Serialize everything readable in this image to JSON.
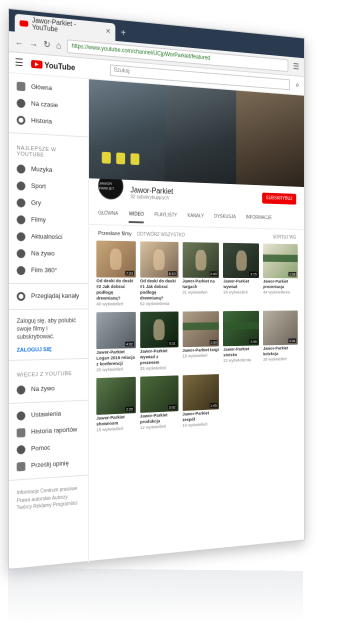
{
  "browser": {
    "tab_title": "Jawor-Parkiet - YouTube",
    "new_tab": "+",
    "url": "https://www.youtube.com/channel/UCjpWorParkiet/featured",
    "nav_icons": [
      "back-icon",
      "forward-icon",
      "refresh-icon",
      "home-icon"
    ]
  },
  "yt": {
    "logo_text": "YouTube",
    "search_placeholder": "Szukaj"
  },
  "sidebar": {
    "primary": [
      {
        "label": "Główna",
        "icon": "home-icon"
      },
      {
        "label": "Na czasie",
        "icon": "fire-icon"
      },
      {
        "label": "Historia",
        "icon": "history-icon"
      }
    ],
    "best_header": "NAJLEPSZE W YOUTUBE",
    "best": [
      {
        "label": "Muzyka"
      },
      {
        "label": "Sport"
      },
      {
        "label": "Gry"
      },
      {
        "label": "Filmy"
      },
      {
        "label": "Aktualności"
      },
      {
        "label": "Na żywo"
      },
      {
        "label": "Film 360°"
      }
    ],
    "browse": "Przeglądaj kanały",
    "signin_text": "Zaloguj się, aby polubić swoje filmy i subskrybować.",
    "signin_button": "ZALOGUJ SIĘ",
    "more_header": "WIĘCEJ Z YOUTUBE",
    "more": [
      {
        "label": "Na żywo"
      }
    ],
    "settings": [
      {
        "label": "Ustawienia"
      },
      {
        "label": "Historia raportów"
      },
      {
        "label": "Pomoc"
      },
      {
        "label": "Prześlij opinię"
      }
    ],
    "footer": "Informacje  Centrum prasowe  Prawa autorskie  Autorzy  Twórcy  Reklamy  Programiści"
  },
  "channel": {
    "avatar_text": "JAWOR PARKIET",
    "name": "Jawor-Parkiet",
    "subscribers": "92 subskrybujących",
    "subscribe": "SUBSKRYBUJ",
    "tabs": [
      "GŁÓWNA",
      "WIDEO",
      "PLAYLISTY",
      "KANAŁY",
      "DYSKUSJA",
      "INFORMACJE"
    ],
    "active_tab": "WIDEO",
    "section_title": "Przesłane filmy",
    "play_all": "ODTWÓRZ WSZYSTKO",
    "sort": "SORTUJ WG"
  },
  "videos": [
    {
      "title": "Od deski do deski #2 Jak dobrać podłogę drewnianą?",
      "meta": "40 wyświetleń",
      "dur": "7:23"
    },
    {
      "title": "Od deski do deski #1 Jak dobrać podłogę drewnianą?",
      "meta": "52 wyświetlenia",
      "dur": "6:10"
    },
    {
      "title": "Jawor-Parkiet na targach",
      "meta": "31 wyświetleń",
      "dur": "2:40"
    },
    {
      "title": "Jawor-Parkiet wywiad",
      "meta": "28 wyświetleń",
      "dur": "3:15"
    },
    {
      "title": "Jawor-Parkiet prezentacja",
      "meta": "44 wyświetlenia",
      "dur": "1:58"
    },
    {
      "title": "Jawor-Parkiet Logan 2019 relacja z konferencji",
      "meta": "20 wyświetleń",
      "dur": "4:02"
    },
    {
      "title": "Jawor-Parkiet wywiad z prezesem",
      "meta": "35 wyświetleń",
      "dur": "5:11"
    },
    {
      "title": "Jawor-Parkiet targi",
      "meta": "18 wyświetleń",
      "dur": "1:30"
    },
    {
      "title": "Jawor-Parkiet stoisko",
      "meta": "22 wyświetlenia",
      "dur": "2:05"
    },
    {
      "title": "Jawor-Parkiet kolekcja",
      "meta": "26 wyświetleń",
      "dur": "3:44"
    },
    {
      "title": "Jawor-Parkiet showroom",
      "meta": "15 wyświetleń",
      "dur": "2:20"
    },
    {
      "title": "Jawor-Parkiet produkcja",
      "meta": "12 wyświetleń",
      "dur": "3:02"
    },
    {
      "title": "Jawor-Parkiet zespół",
      "meta": "19 wyświetleń",
      "dur": "1:45"
    }
  ]
}
